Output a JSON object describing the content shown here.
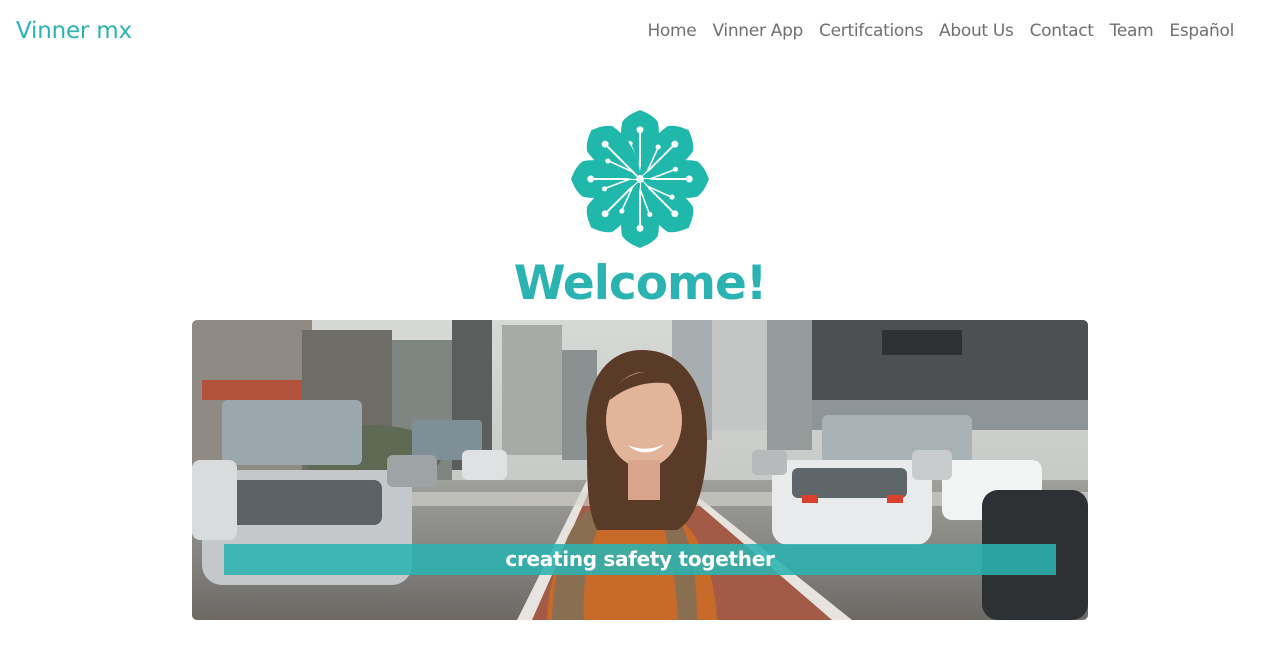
{
  "navbar": {
    "brand": "Vinner mx",
    "links": [
      "Home",
      "Vinner App",
      "Certifcations",
      "About Us",
      "Contact",
      "Team",
      "Español"
    ]
  },
  "logo": {
    "icon": "flower-logo-icon",
    "color": "#1fb8aa"
  },
  "hero": {
    "heading": "Welcome!",
    "caption": "creating safety together",
    "image": "smiling-woman-on-city-street-photo"
  },
  "colors": {
    "accent": "#2bb3b1",
    "nav_text": "#707070"
  }
}
